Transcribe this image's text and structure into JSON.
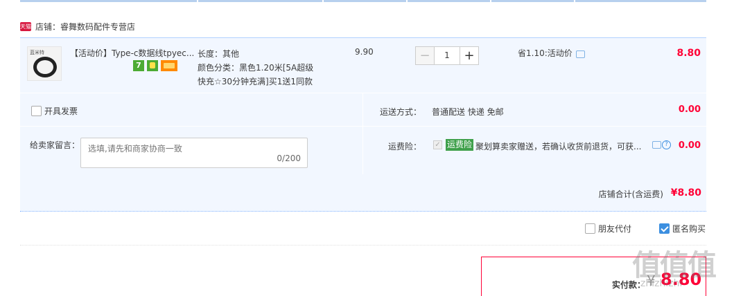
{
  "shop": {
    "badge": "天猫",
    "label": "店铺：睿舞数码配件专营店"
  },
  "item": {
    "thumb_brand": "蓝米特",
    "title": "【活动价】Type-c数据线tpyec...",
    "service_7": "7",
    "sku_length": "长度：其他",
    "sku_color": "颜色分类：黑色1.20米[5A超级快充☆30分钟充满]买1送1同款",
    "unit_price": "9.90",
    "quantity": "1",
    "minus": "−",
    "plus": "+",
    "discount": "省1.10:活动价",
    "total": "8.80"
  },
  "options": {
    "invoice_label": "开具发票",
    "message_label": "给卖家留言：",
    "message_placeholder": "选填,请先和商家协商一致",
    "message_count": "0/200",
    "shipping_label": "运送方式：",
    "shipping_value": "普通配送 快递 免邮",
    "shipping_fee": "0.00",
    "insurance_label": "运费险：",
    "insurance_badge": "运费险",
    "insurance_desc": "聚划算卖家赠送，若确认收货前退货，可获...",
    "insurance_fee": "0.00",
    "help_glyph": "?",
    "check_glyph": "✓"
  },
  "subtotal": {
    "label": "店铺合计(含运费)",
    "value": "¥8.80"
  },
  "extras": {
    "friend_pay": "朋友代付",
    "anonymous": "匿名购买"
  },
  "payment": {
    "label": "实付款：",
    "yen": "¥",
    "value": "8.80"
  },
  "watermark": {
    "main": "值值值",
    "sub": "zhizhizhi"
  }
}
